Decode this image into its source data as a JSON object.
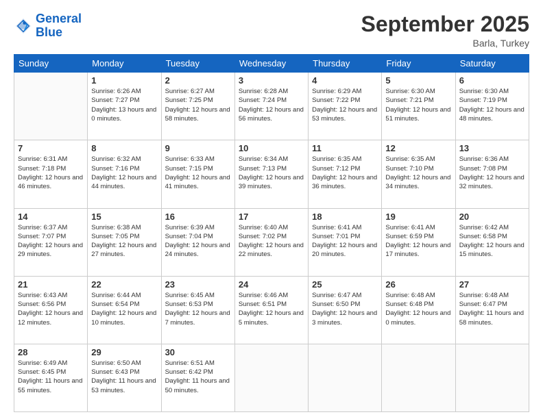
{
  "logo": {
    "line1": "General",
    "line2": "Blue"
  },
  "title": "September 2025",
  "location": "Barla, Turkey",
  "weekdays": [
    "Sunday",
    "Monday",
    "Tuesday",
    "Wednesday",
    "Thursday",
    "Friday",
    "Saturday"
  ],
  "weeks": [
    [
      {
        "day": "",
        "info": ""
      },
      {
        "day": "1",
        "info": "Sunrise: 6:26 AM\nSunset: 7:27 PM\nDaylight: 13 hours\nand 0 minutes."
      },
      {
        "day": "2",
        "info": "Sunrise: 6:27 AM\nSunset: 7:25 PM\nDaylight: 12 hours\nand 58 minutes."
      },
      {
        "day": "3",
        "info": "Sunrise: 6:28 AM\nSunset: 7:24 PM\nDaylight: 12 hours\nand 56 minutes."
      },
      {
        "day": "4",
        "info": "Sunrise: 6:29 AM\nSunset: 7:22 PM\nDaylight: 12 hours\nand 53 minutes."
      },
      {
        "day": "5",
        "info": "Sunrise: 6:30 AM\nSunset: 7:21 PM\nDaylight: 12 hours\nand 51 minutes."
      },
      {
        "day": "6",
        "info": "Sunrise: 6:30 AM\nSunset: 7:19 PM\nDaylight: 12 hours\nand 48 minutes."
      }
    ],
    [
      {
        "day": "7",
        "info": "Sunrise: 6:31 AM\nSunset: 7:18 PM\nDaylight: 12 hours\nand 46 minutes."
      },
      {
        "day": "8",
        "info": "Sunrise: 6:32 AM\nSunset: 7:16 PM\nDaylight: 12 hours\nand 44 minutes."
      },
      {
        "day": "9",
        "info": "Sunrise: 6:33 AM\nSunset: 7:15 PM\nDaylight: 12 hours\nand 41 minutes."
      },
      {
        "day": "10",
        "info": "Sunrise: 6:34 AM\nSunset: 7:13 PM\nDaylight: 12 hours\nand 39 minutes."
      },
      {
        "day": "11",
        "info": "Sunrise: 6:35 AM\nSunset: 7:12 PM\nDaylight: 12 hours\nand 36 minutes."
      },
      {
        "day": "12",
        "info": "Sunrise: 6:35 AM\nSunset: 7:10 PM\nDaylight: 12 hours\nand 34 minutes."
      },
      {
        "day": "13",
        "info": "Sunrise: 6:36 AM\nSunset: 7:08 PM\nDaylight: 12 hours\nand 32 minutes."
      }
    ],
    [
      {
        "day": "14",
        "info": "Sunrise: 6:37 AM\nSunset: 7:07 PM\nDaylight: 12 hours\nand 29 minutes."
      },
      {
        "day": "15",
        "info": "Sunrise: 6:38 AM\nSunset: 7:05 PM\nDaylight: 12 hours\nand 27 minutes."
      },
      {
        "day": "16",
        "info": "Sunrise: 6:39 AM\nSunset: 7:04 PM\nDaylight: 12 hours\nand 24 minutes."
      },
      {
        "day": "17",
        "info": "Sunrise: 6:40 AM\nSunset: 7:02 PM\nDaylight: 12 hours\nand 22 minutes."
      },
      {
        "day": "18",
        "info": "Sunrise: 6:41 AM\nSunset: 7:01 PM\nDaylight: 12 hours\nand 20 minutes."
      },
      {
        "day": "19",
        "info": "Sunrise: 6:41 AM\nSunset: 6:59 PM\nDaylight: 12 hours\nand 17 minutes."
      },
      {
        "day": "20",
        "info": "Sunrise: 6:42 AM\nSunset: 6:58 PM\nDaylight: 12 hours\nand 15 minutes."
      }
    ],
    [
      {
        "day": "21",
        "info": "Sunrise: 6:43 AM\nSunset: 6:56 PM\nDaylight: 12 hours\nand 12 minutes."
      },
      {
        "day": "22",
        "info": "Sunrise: 6:44 AM\nSunset: 6:54 PM\nDaylight: 12 hours\nand 10 minutes."
      },
      {
        "day": "23",
        "info": "Sunrise: 6:45 AM\nSunset: 6:53 PM\nDaylight: 12 hours\nand 7 minutes."
      },
      {
        "day": "24",
        "info": "Sunrise: 6:46 AM\nSunset: 6:51 PM\nDaylight: 12 hours\nand 5 minutes."
      },
      {
        "day": "25",
        "info": "Sunrise: 6:47 AM\nSunset: 6:50 PM\nDaylight: 12 hours\nand 3 minutes."
      },
      {
        "day": "26",
        "info": "Sunrise: 6:48 AM\nSunset: 6:48 PM\nDaylight: 12 hours\nand 0 minutes."
      },
      {
        "day": "27",
        "info": "Sunrise: 6:48 AM\nSunset: 6:47 PM\nDaylight: 11 hours\nand 58 minutes."
      }
    ],
    [
      {
        "day": "28",
        "info": "Sunrise: 6:49 AM\nSunset: 6:45 PM\nDaylight: 11 hours\nand 55 minutes."
      },
      {
        "day": "29",
        "info": "Sunrise: 6:50 AM\nSunset: 6:43 PM\nDaylight: 11 hours\nand 53 minutes."
      },
      {
        "day": "30",
        "info": "Sunrise: 6:51 AM\nSunset: 6:42 PM\nDaylight: 11 hours\nand 50 minutes."
      },
      {
        "day": "",
        "info": ""
      },
      {
        "day": "",
        "info": ""
      },
      {
        "day": "",
        "info": ""
      },
      {
        "day": "",
        "info": ""
      }
    ]
  ]
}
